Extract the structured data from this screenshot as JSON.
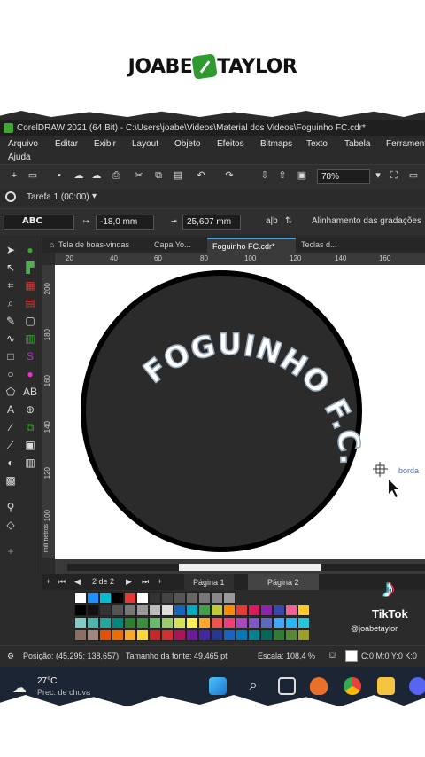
{
  "watermark": {
    "left": "JOABE",
    "right": "TAYLOR"
  },
  "window": {
    "title": "CorelDRAW 2021 (64 Bit) - C:\\Users\\joabe\\Videos\\Material dos Videos\\Foguinho FC.cdr*"
  },
  "menu": [
    "Arquivo",
    "Editar",
    "Exibir",
    "Layout",
    "Objeto",
    "Efeitos",
    "Bitmaps",
    "Texto",
    "Tabela",
    "Ferrament",
    "Ajuda"
  ],
  "toolbar": {
    "zoom": "78%"
  },
  "task": {
    "label": "Tarefa 1 (00:00)"
  },
  "properties": {
    "field1": "-18,0 mm",
    "field2": "25,607 mm",
    "gradient_label": "Alinhamento das gradações"
  },
  "doc_tabs": [
    "Tela de boas-vindas",
    "Capa Yo...",
    "Foguinho FC.cdr*",
    "Teclas d..."
  ],
  "ruler": {
    "h_ticks": [
      "20",
      "40",
      "60",
      "80",
      "100",
      "120",
      "140",
      "160"
    ],
    "v_ticks": [
      "200",
      "180",
      "160",
      "140",
      "120",
      "100"
    ],
    "unit": "milímetros"
  },
  "artwork": {
    "curved_text": "FOGUINHO F.C.",
    "hint": "borda"
  },
  "pager": {
    "count": "2 de 2",
    "page1": "Página 1",
    "page2": "Página 2"
  },
  "status": {
    "position": "Posição: (45,295; 138,657)",
    "font_size": "Tamanho da fonte: 49,465 pt",
    "scale": "Escala: 108,4 %",
    "color": "C:0 M:0 Y:0 K:0"
  },
  "taskbar": {
    "weather_temp": "27°C",
    "weather_desc": "Prec. de chuva"
  },
  "tiktok": {
    "brand": "TikTok",
    "handle": "@joabetaylor"
  },
  "colors": {
    "accent": "#2e9a2f",
    "app_bg": "#2b2b2b",
    "circle_fill": "#2b2b2b",
    "text_fill": "#ffffff"
  }
}
